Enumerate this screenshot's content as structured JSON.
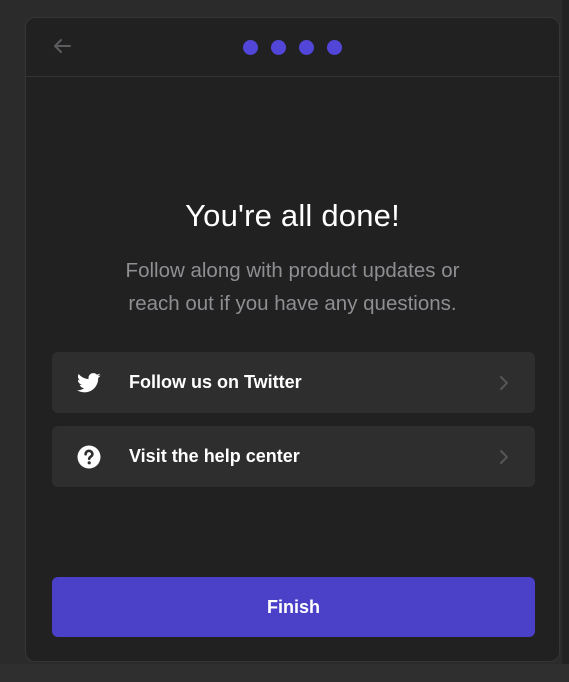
{
  "theme": {
    "accent": "#4b41c8",
    "dot_active": "#5146d8",
    "modal_bg": "#212121",
    "row_bg": "#2e2e2f"
  },
  "header": {
    "back_icon": "arrow-left-icon",
    "steps_total": 4,
    "steps_completed": 4
  },
  "content": {
    "title": "You're all done!",
    "subtitle_line1": "Follow along with product updates or",
    "subtitle_line2": "reach out if you have any questions."
  },
  "links": [
    {
      "label": "Follow us on Twitter",
      "icon": "twitter-icon",
      "trail_icon": "chevron-right-icon"
    },
    {
      "label": "Visit the help center",
      "icon": "question-circle-icon",
      "trail_icon": "chevron-right-icon"
    }
  ],
  "footer": {
    "finish_label": "Finish"
  }
}
